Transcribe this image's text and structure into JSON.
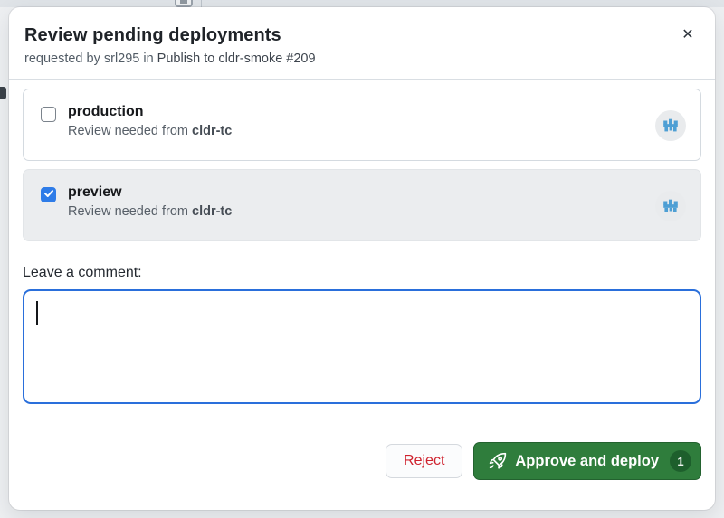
{
  "dialog": {
    "title": "Review pending deployments",
    "subtitle": {
      "prefix": "requested by srl295 in",
      "workflow": "Publish to cldr-smoke #209"
    },
    "close_icon": "✕"
  },
  "environments": [
    {
      "name": "production",
      "review_text": "Review needed from",
      "team": "cldr-tc",
      "checked": false
    },
    {
      "name": "preview",
      "review_text": "Review needed from",
      "team": "cldr-tc",
      "checked": true
    }
  ],
  "comment": {
    "label": "Leave a comment:",
    "value": ""
  },
  "actions": {
    "reject": "Reject",
    "approve": "Approve and deploy",
    "approve_count": "1"
  },
  "icons": {
    "checkbox_checked": "checkmark-icon",
    "environment_avatar": "cldr-team-avatar",
    "approve_button": "rocket-icon",
    "close": "close-icon"
  },
  "colors": {
    "textarea_focus_border": "#2a6fdb",
    "checkbox_checked_blue": "#2e7ce8",
    "approve_green": "#2f7d3c",
    "approve_badge_green": "#1d5f2c",
    "reject_red": "#cf222e",
    "avatar_logo_blue": "#4e9fd4",
    "selected_row_bg": "#ebedef",
    "page_bg": "#eef0f2"
  }
}
